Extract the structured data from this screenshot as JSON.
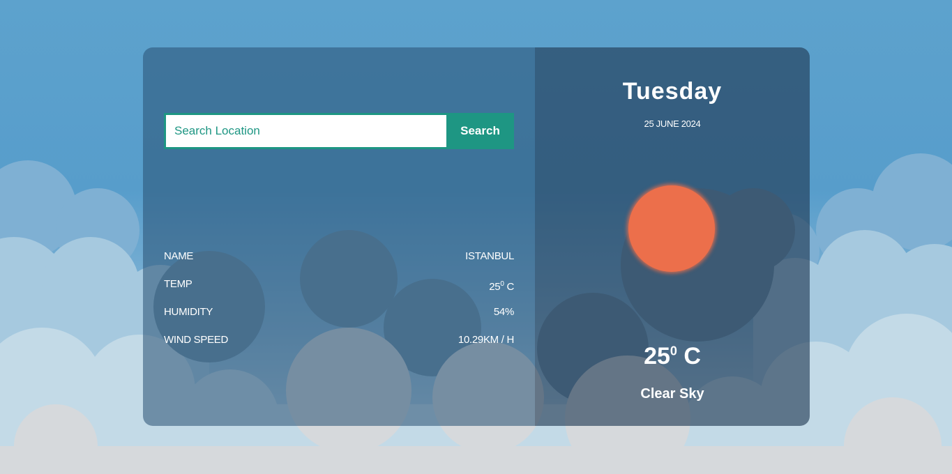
{
  "search": {
    "placeholder": "Search Location",
    "button_label": "Search"
  },
  "details": [
    {
      "label": "NAME",
      "value": "ISTANBUL"
    },
    {
      "label": "TEMP",
      "value_main": "25",
      "value_sup": "0",
      "value_unit": " C"
    },
    {
      "label": "HUMIDITY",
      "value": "54%"
    },
    {
      "label": "WIND SPEED",
      "value": "10.29KM / H"
    }
  ],
  "summary": {
    "day": "Tuesday",
    "date": "25 JUNE 2024",
    "temp_main": "25",
    "temp_sup": "0",
    "temp_unit": " C",
    "condition": "Clear Sky"
  },
  "colors": {
    "accent": "#1e9683",
    "sun": "#ec6f4b",
    "sky": "#5da2cd"
  },
  "icons": {
    "weather": "sun-icon"
  }
}
